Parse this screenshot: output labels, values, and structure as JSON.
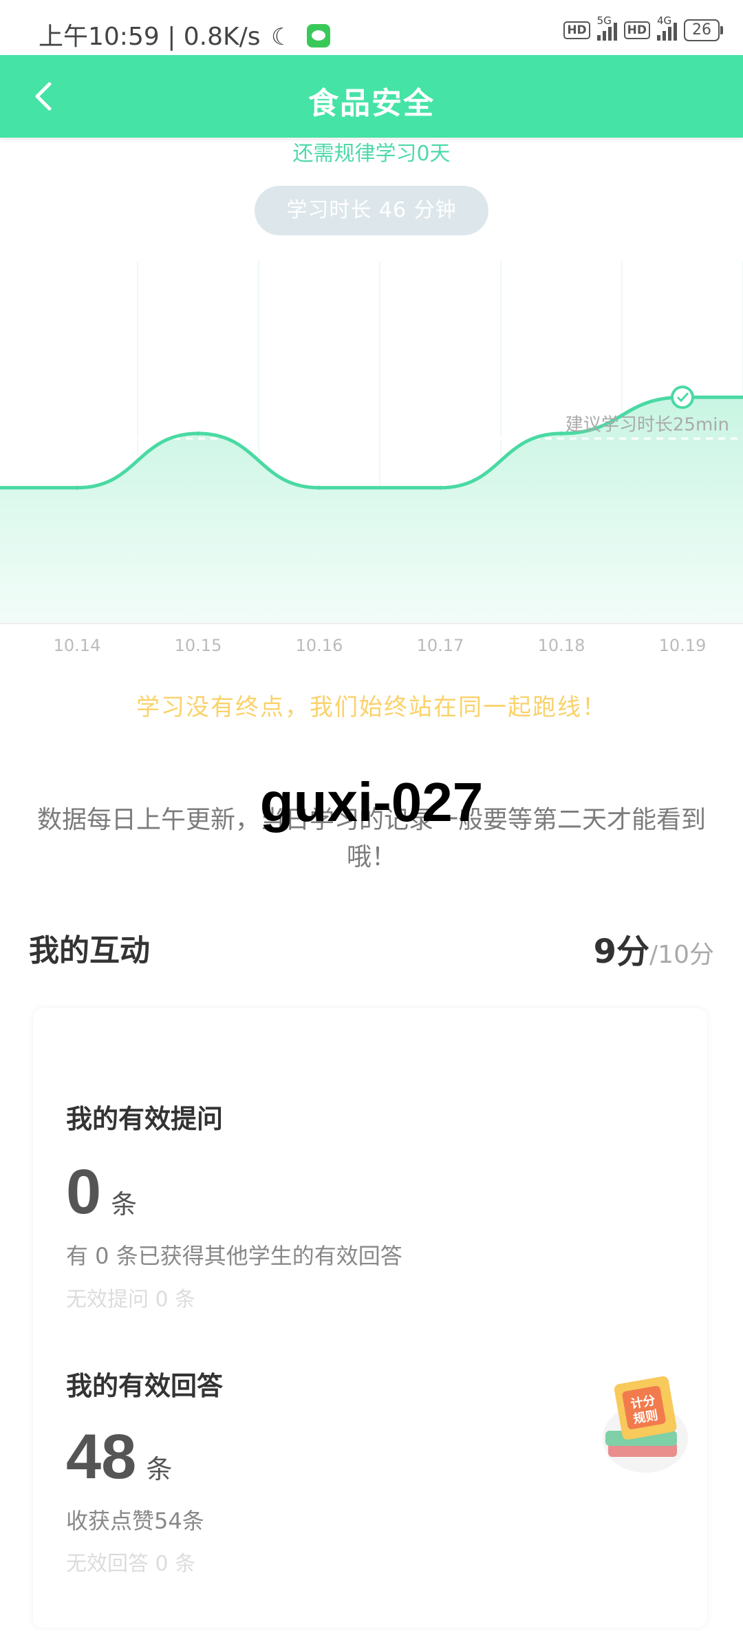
{
  "status_bar": {
    "time": "上午10:59",
    "net_speed": "0.8K/s",
    "sim1_type": "5G",
    "sim2_type": "4G",
    "hd_label": "HD",
    "battery": "26"
  },
  "header": {
    "title": "食品安全"
  },
  "summary": {
    "remaining_text": "还需规律学习0天",
    "duration_text": "学习时长 46 分钟"
  },
  "chart_data": {
    "type": "area",
    "x": [
      "10.14",
      "10.15",
      "10.16",
      "10.17",
      "10.18",
      "10.19"
    ],
    "values": [
      15,
      21,
      15,
      15,
      21,
      25
    ],
    "ylim": [
      0,
      40
    ],
    "reference_line": {
      "value": 25,
      "label": "建议学习时长25min"
    },
    "highlight_index": 5,
    "grid": true,
    "colors": {
      "line": "#4ad9a3",
      "fill_top": "#c9f5e3",
      "fill_bottom": "#f3fdf9",
      "ref": "#dddddd"
    }
  },
  "motto": "学习没有终点，我们始终站在同一起跑线！",
  "notice": "数据每日上午更新，当日学习的记录一般要等第二天才能看到哦！",
  "watermark": "guxi-027",
  "interaction": {
    "title": "我的互动",
    "score": "9分",
    "score_total": "/10分",
    "questions": {
      "title": "我的有效提问",
      "count": "0",
      "unit": "条",
      "detail": "有 0 条已获得其他学生的有效回答",
      "invalid": "无效提问 0 条"
    },
    "answers": {
      "title": "我的有效回答",
      "count": "48",
      "unit": "条",
      "detail": "收获点赞54条",
      "invalid": "无效回答 0 条"
    },
    "badge_text": "计分规则"
  }
}
